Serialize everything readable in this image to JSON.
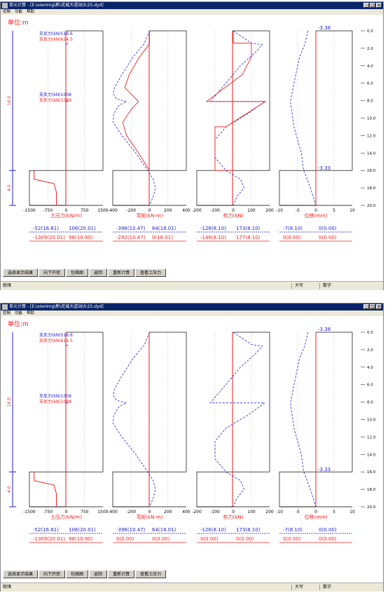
{
  "windows": [
    {
      "title": "单元计算 - [E:\\xieming\\新\\花城大道站\\fc25.dyd]",
      "menu": [
        "控制",
        "功能",
        "帮助"
      ],
      "unit_label": "单位:m",
      "depth_label_upper": "16.0",
      "depth_label_lower": "4.0",
      "depth_ticks": [
        "0.0",
        "2.0",
        "4.0",
        "6.0",
        "8.0",
        "10.0",
        "12.0",
        "14.0",
        "16.0",
        "18.0",
        "20.0"
      ],
      "support_labels": [
        {
          "text": "支反力(kN)516.6",
          "color": "#2222cc"
        },
        {
          "text": "支反力(kN)614.5",
          "color": "#ee2222"
        },
        {
          "text": "支反力(kN)1008",
          "color": "#2222cc"
        },
        {
          "text": "支反力(kN)1088",
          "color": "#ee2222"
        }
      ],
      "displacement_top": "-3.38",
      "displacement_mid": "-3.33",
      "panels": [
        {
          "axis_ticks": [
            "-1500",
            "-750",
            "0",
            "750",
            "1500"
          ],
          "title": "土压力(kN/m)"
        },
        {
          "axis_ticks": [
            "-400",
            "-200",
            "0",
            "200",
            "400"
          ],
          "title": "弯矩(kN-m)"
        },
        {
          "axis_ticks": [
            "-200",
            "-100",
            "0",
            "100",
            "200"
          ],
          "title": "剪力(kN)"
        },
        {
          "axis_ticks": [
            "-10",
            "-5",
            "0",
            "5",
            "10"
          ],
          "title": "位移(mm)"
        }
      ],
      "summary": [
        {
          "blue": [
            "-52(16.81)",
            "106(20.01)"
          ],
          "red": [
            "-1309(20.01)",
            "98(10.90)"
          ]
        },
        {
          "blue": [
            "-396(10.47)",
            "64(18.01)"
          ],
          "red": [
            "-292(10.47)",
            "0(16.01)"
          ]
        },
        {
          "blue": [
            "-126(8.10)",
            "173(8.10)"
          ],
          "red": [
            "-146(8.10)",
            "177(8.10)"
          ]
        },
        {
          "blue": [
            "-7(8.10)",
            "0(0.00)"
          ],
          "red": [
            "0(0.00)",
            "0(0.00)"
          ]
        }
      ],
      "buttons": [
        "选择显示结果",
        "向下开挖",
        "包络图",
        "返回",
        "重新计算",
        "查看土压力"
      ],
      "status": [
        "就绪",
        "大写",
        "数字"
      ]
    },
    {
      "title": "单元计算 - [E:\\xieming\\新\\花城大道站\\fc25.dyd]",
      "menu": [
        "控制",
        "功能",
        "帮助"
      ],
      "unit_label": "单位:m",
      "depth_label_upper": "16.0",
      "depth_label_lower": "4.0",
      "depth_ticks": [
        "0.0",
        "2.0",
        "4.0",
        "6.0",
        "8.0",
        "10.0",
        "12.0",
        "14.0",
        "16.0",
        "18.0",
        "20.0"
      ],
      "support_labels": [
        {
          "text": "支反力(kN)516.6",
          "color": "#2222cc"
        },
        {
          "text": "支反力(kN)614.5",
          "color": "#ee2222"
        },
        {
          "text": "支反力(kN)1008",
          "color": "#2222cc"
        },
        {
          "text": "支反力(kN)1088",
          "color": "#ee2222"
        }
      ],
      "displacement_top": "-3.38",
      "displacement_mid": "-3.33",
      "panels": [
        {
          "axis_ticks": [
            "-1500",
            "-750",
            "0",
            "750",
            "1500"
          ],
          "title": "土压力(kN/m)"
        },
        {
          "axis_ticks": [
            "-400",
            "-200",
            "0",
            "200",
            "400"
          ],
          "title": "弯矩(kN-m)"
        },
        {
          "axis_ticks": [
            "-200",
            "-100",
            "0",
            "100",
            "200"
          ],
          "title": "剪力(kN)"
        },
        {
          "axis_ticks": [
            "-10",
            "-5",
            "0",
            "5",
            "10"
          ],
          "title": "位移(mm)"
        }
      ],
      "summary": [
        {
          "blue": [
            "-52(16.81)",
            "106(20.01)"
          ],
          "red": [
            "-1309(20.01)",
            "98(10.90)"
          ]
        },
        {
          "blue": [
            "-396(10.47)",
            "64(18.01)"
          ],
          "red": [
            "0(0.00)",
            "0(0.00)"
          ]
        },
        {
          "blue": [
            "-126(8.10)",
            "173(8.10)"
          ],
          "red": [
            "0(0.00)",
            "0(0.00)"
          ]
        },
        {
          "blue": [
            "-7(8.10)",
            "0(0.00)"
          ],
          "red": [
            "0(0.00)",
            "0(0.00)"
          ]
        }
      ],
      "buttons": [
        "选择显示结果",
        "向下开挖",
        "包络图",
        "返回",
        "重新计算",
        "查看土压力"
      ],
      "status": [
        "就绪",
        "大写",
        "数字"
      ]
    }
  ],
  "colors": {
    "blue": "#2222cc",
    "red": "#ee2222",
    "title_bar": "#0a246a"
  }
}
